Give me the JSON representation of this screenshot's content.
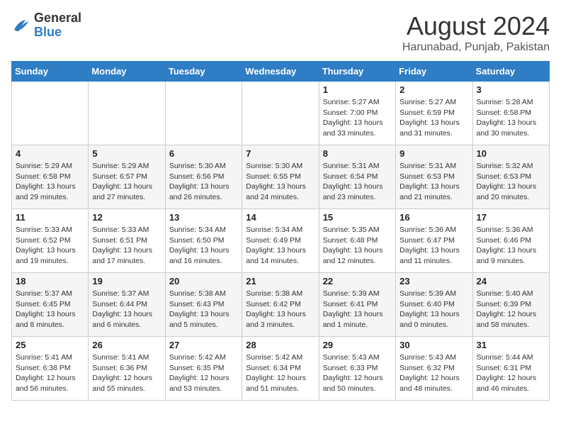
{
  "header": {
    "logo_general": "General",
    "logo_blue": "Blue",
    "month_title": "August 2024",
    "location": "Harunabad, Punjab, Pakistan"
  },
  "weekdays": [
    "Sunday",
    "Monday",
    "Tuesday",
    "Wednesday",
    "Thursday",
    "Friday",
    "Saturday"
  ],
  "weeks": [
    [
      {
        "day": "",
        "info": ""
      },
      {
        "day": "",
        "info": ""
      },
      {
        "day": "",
        "info": ""
      },
      {
        "day": "",
        "info": ""
      },
      {
        "day": "1",
        "info": "Sunrise: 5:27 AM\nSunset: 7:00 PM\nDaylight: 13 hours\nand 33 minutes."
      },
      {
        "day": "2",
        "info": "Sunrise: 5:27 AM\nSunset: 6:59 PM\nDaylight: 13 hours\nand 31 minutes."
      },
      {
        "day": "3",
        "info": "Sunrise: 5:28 AM\nSunset: 6:58 PM\nDaylight: 13 hours\nand 30 minutes."
      }
    ],
    [
      {
        "day": "4",
        "info": "Sunrise: 5:29 AM\nSunset: 6:58 PM\nDaylight: 13 hours\nand 29 minutes."
      },
      {
        "day": "5",
        "info": "Sunrise: 5:29 AM\nSunset: 6:57 PM\nDaylight: 13 hours\nand 27 minutes."
      },
      {
        "day": "6",
        "info": "Sunrise: 5:30 AM\nSunset: 6:56 PM\nDaylight: 13 hours\nand 26 minutes."
      },
      {
        "day": "7",
        "info": "Sunrise: 5:30 AM\nSunset: 6:55 PM\nDaylight: 13 hours\nand 24 minutes."
      },
      {
        "day": "8",
        "info": "Sunrise: 5:31 AM\nSunset: 6:54 PM\nDaylight: 13 hours\nand 23 minutes."
      },
      {
        "day": "9",
        "info": "Sunrise: 5:31 AM\nSunset: 6:53 PM\nDaylight: 13 hours\nand 21 minutes."
      },
      {
        "day": "10",
        "info": "Sunrise: 5:32 AM\nSunset: 6:53 PM\nDaylight: 13 hours\nand 20 minutes."
      }
    ],
    [
      {
        "day": "11",
        "info": "Sunrise: 5:33 AM\nSunset: 6:52 PM\nDaylight: 13 hours\nand 19 minutes."
      },
      {
        "day": "12",
        "info": "Sunrise: 5:33 AM\nSunset: 6:51 PM\nDaylight: 13 hours\nand 17 minutes."
      },
      {
        "day": "13",
        "info": "Sunrise: 5:34 AM\nSunset: 6:50 PM\nDaylight: 13 hours\nand 16 minutes."
      },
      {
        "day": "14",
        "info": "Sunrise: 5:34 AM\nSunset: 6:49 PM\nDaylight: 13 hours\nand 14 minutes."
      },
      {
        "day": "15",
        "info": "Sunrise: 5:35 AM\nSunset: 6:48 PM\nDaylight: 13 hours\nand 12 minutes."
      },
      {
        "day": "16",
        "info": "Sunrise: 5:36 AM\nSunset: 6:47 PM\nDaylight: 13 hours\nand 11 minutes."
      },
      {
        "day": "17",
        "info": "Sunrise: 5:36 AM\nSunset: 6:46 PM\nDaylight: 13 hours\nand 9 minutes."
      }
    ],
    [
      {
        "day": "18",
        "info": "Sunrise: 5:37 AM\nSunset: 6:45 PM\nDaylight: 13 hours\nand 8 minutes."
      },
      {
        "day": "19",
        "info": "Sunrise: 5:37 AM\nSunset: 6:44 PM\nDaylight: 13 hours\nand 6 minutes."
      },
      {
        "day": "20",
        "info": "Sunrise: 5:38 AM\nSunset: 6:43 PM\nDaylight: 13 hours\nand 5 minutes."
      },
      {
        "day": "21",
        "info": "Sunrise: 5:38 AM\nSunset: 6:42 PM\nDaylight: 13 hours\nand 3 minutes."
      },
      {
        "day": "22",
        "info": "Sunrise: 5:39 AM\nSunset: 6:41 PM\nDaylight: 13 hours\nand 1 minute."
      },
      {
        "day": "23",
        "info": "Sunrise: 5:39 AM\nSunset: 6:40 PM\nDaylight: 13 hours\nand 0 minutes."
      },
      {
        "day": "24",
        "info": "Sunrise: 5:40 AM\nSunset: 6:39 PM\nDaylight: 12 hours\nand 58 minutes."
      }
    ],
    [
      {
        "day": "25",
        "info": "Sunrise: 5:41 AM\nSunset: 6:38 PM\nDaylight: 12 hours\nand 56 minutes."
      },
      {
        "day": "26",
        "info": "Sunrise: 5:41 AM\nSunset: 6:36 PM\nDaylight: 12 hours\nand 55 minutes."
      },
      {
        "day": "27",
        "info": "Sunrise: 5:42 AM\nSunset: 6:35 PM\nDaylight: 12 hours\nand 53 minutes."
      },
      {
        "day": "28",
        "info": "Sunrise: 5:42 AM\nSunset: 6:34 PM\nDaylight: 12 hours\nand 51 minutes."
      },
      {
        "day": "29",
        "info": "Sunrise: 5:43 AM\nSunset: 6:33 PM\nDaylight: 12 hours\nand 50 minutes."
      },
      {
        "day": "30",
        "info": "Sunrise: 5:43 AM\nSunset: 6:32 PM\nDaylight: 12 hours\nand 48 minutes."
      },
      {
        "day": "31",
        "info": "Sunrise: 5:44 AM\nSunset: 6:31 PM\nDaylight: 12 hours\nand 46 minutes."
      }
    ]
  ]
}
